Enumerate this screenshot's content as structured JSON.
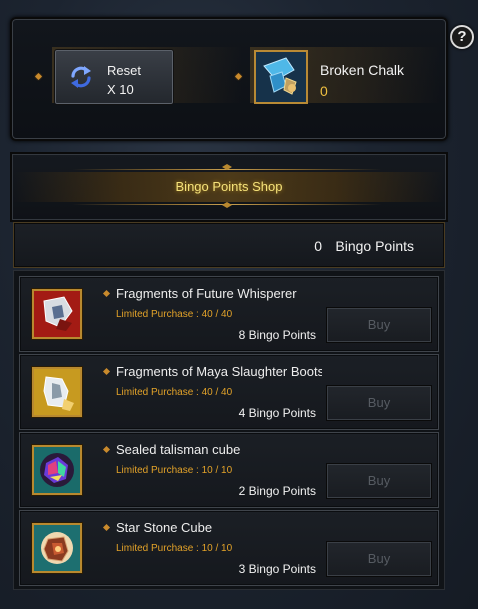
{
  "help": {
    "glyph": "?"
  },
  "resources": {
    "reset": {
      "label": "Reset",
      "count": "X 10"
    },
    "chalk": {
      "name": "Broken Chalk",
      "count": "0"
    }
  },
  "shop": {
    "title": "Bingo Points Shop",
    "points_value": "0",
    "points_label": "Bingo Points"
  },
  "items": [
    {
      "name": "Fragments of Future Whisperer",
      "limit": "Limited Purchase : 40 / 40",
      "price": "8 Bingo Points",
      "buy_label": "Buy",
      "icon": "future-whisperer-fragment-icon",
      "icon_bg": "#a31b14"
    },
    {
      "name": "Fragments of Maya Slaughter Boots",
      "limit": "Limited Purchase : 40 / 40",
      "price": "4 Bingo Points",
      "buy_label": "Buy",
      "icon": "maya-slaughter-fragment-icon",
      "icon_bg": "#c79a20"
    },
    {
      "name": "Sealed talisman cube",
      "limit": "Limited Purchase : 10 / 10",
      "price": "2 Bingo Points",
      "buy_label": "Buy",
      "icon": "talisman-cube-icon",
      "icon_bg": "#1a6b6a"
    },
    {
      "name": "Star Stone Cube",
      "limit": "Limited Purchase : 10 / 10",
      "price": "3 Bingo Points",
      "buy_label": "Buy",
      "icon": "star-stone-cube-icon",
      "icon_bg": "#1d6f70"
    }
  ],
  "colors": {
    "accent_gold": "#f5e27a",
    "limit_orange": "#e2a229",
    "count_yellow": "#f0c040"
  }
}
